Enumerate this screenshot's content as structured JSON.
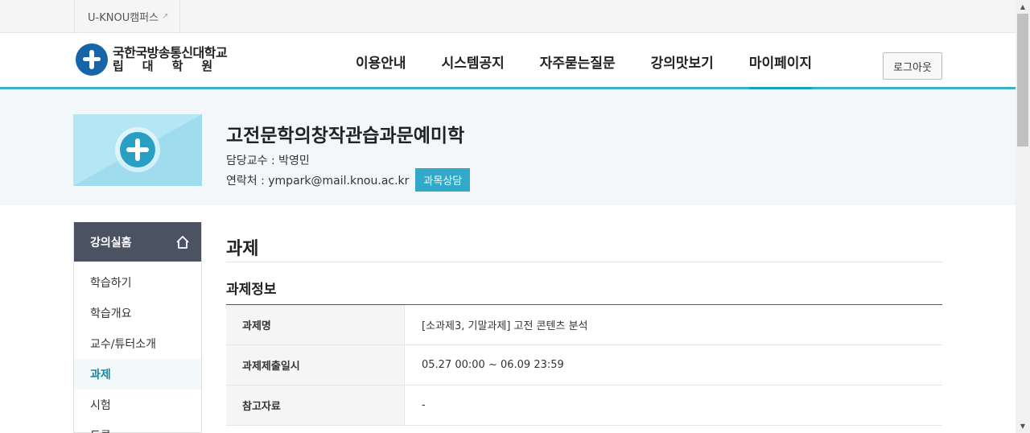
{
  "utilbar": {
    "campus_label": "U-KNOU캠퍼스",
    "ext_icon": "external-link-icon"
  },
  "header": {
    "logo": {
      "line1": "국한국방송통신대학교",
      "line2": "립대학원"
    },
    "nav": [
      "이용안내",
      "시스템공지",
      "자주묻는질문",
      "강의맛보기",
      "마이페이지"
    ],
    "active_nav_index": 4,
    "logout_label": "로그아웃"
  },
  "course": {
    "title": "고전문학의창작관습과문예미학",
    "professor": "담당교수 : 박영민",
    "contact": "연락처 : ympark@mail.knou.ac.kr",
    "consult_label": "과목상담"
  },
  "sidebar": {
    "head": "강의실홈",
    "items": [
      "학습하기",
      "학습개요",
      "교수/튜터소개",
      "과제",
      "시험",
      "토론"
    ],
    "active_index": 3
  },
  "main": {
    "page_title": "과제",
    "section_title": "과제정보",
    "rows": [
      {
        "label": "과제명",
        "value": "[소과제3, 기말과제] 고전 콘텐츠 분석"
      },
      {
        "label": "과제제출일시",
        "value": "05.27 00:00 ~ 06.09 23:59"
      },
      {
        "label": "참고자료",
        "value": "-"
      }
    ]
  },
  "colors": {
    "accent": "#3ab1cb",
    "sidebar_head": "#4b5262",
    "consult_button": "#32a9c8"
  }
}
